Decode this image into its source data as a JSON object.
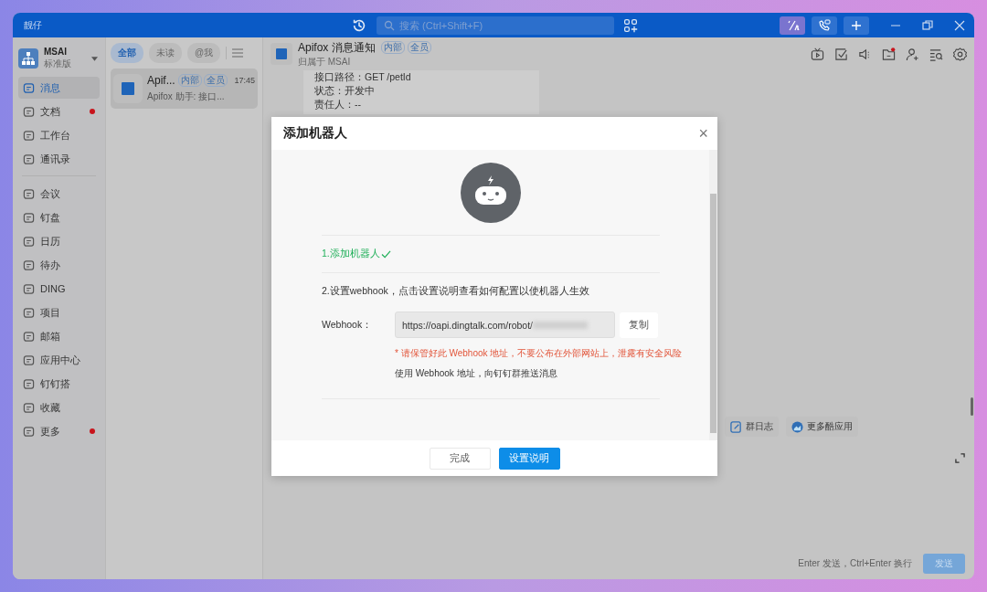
{
  "window": {
    "title": "靓仔"
  },
  "titlebar": {
    "search": {
      "placeholder": "搜索 (Ctrl+Shift+F)"
    }
  },
  "org": {
    "name": "MSAI",
    "plan": "标准版"
  },
  "sidebar": {
    "groups": [
      [
        {
          "label": "消息",
          "selected": true,
          "unread": false
        },
        {
          "label": "文档",
          "selected": false,
          "unread": true
        },
        {
          "label": "工作台",
          "selected": false,
          "unread": false
        },
        {
          "label": "通讯录",
          "selected": false,
          "unread": false
        }
      ],
      [
        {
          "label": "会议",
          "selected": false,
          "unread": false
        },
        {
          "label": "钉盘",
          "selected": false,
          "unread": false
        },
        {
          "label": "日历",
          "selected": false,
          "unread": false
        },
        {
          "label": "待办",
          "selected": false,
          "unread": false
        },
        {
          "label": "DING",
          "selected": false,
          "unread": false
        },
        {
          "label": "项目",
          "selected": false,
          "unread": false
        },
        {
          "label": "邮箱",
          "selected": false,
          "unread": false
        },
        {
          "label": "应用中心",
          "selected": false,
          "unread": false
        },
        {
          "label": "钉钉搭",
          "selected": false,
          "unread": false
        },
        {
          "label": "收藏",
          "selected": false,
          "unread": false
        },
        {
          "label": "更多",
          "selected": false,
          "unread": true
        }
      ]
    ]
  },
  "conversation_filters": [
    {
      "label": "全部",
      "selected": true
    },
    {
      "label": "未读",
      "selected": false
    },
    {
      "label": "@我",
      "selected": false
    }
  ],
  "conversations": [
    {
      "name": "Apif...",
      "tags": [
        "内部",
        "全员"
      ],
      "time": "17:45",
      "preview": "Apifox 助手: 接口...",
      "selected": true
    }
  ],
  "chat": {
    "title": "Apifox 消息通知",
    "tags": [
      "内部",
      "全员"
    ],
    "subtitle": "归属于 MSAI",
    "message_lines": [
      "接口路径：GET /petId",
      "状态：开发中",
      "责任人：--"
    ],
    "quick_apps": [
      "群日志",
      "更多酷应用"
    ],
    "input_hint": "Enter 发送，Ctrl+Enter 换行",
    "send_label": "发送"
  },
  "dialog": {
    "title": "添加机器人",
    "close": "×",
    "step1": "1.添加机器人",
    "step1_done": true,
    "step2": "2.设置webhook，点击设置说明查看如何配置以使机器人生效",
    "webhook_label": "Webhook：",
    "webhook_value": "https://oapi.dingtalk.com/robot/",
    "copy_label": "复制",
    "warning": "* 请保管好此 Webhook 地址，不要公布在外部网站上，泄露有安全风险",
    "note": "使用 Webhook 地址，向钉钉群推送消息",
    "buttons": [
      {
        "label": "完成",
        "primary": false
      },
      {
        "label": "设置说明",
        "primary": true
      }
    ]
  }
}
